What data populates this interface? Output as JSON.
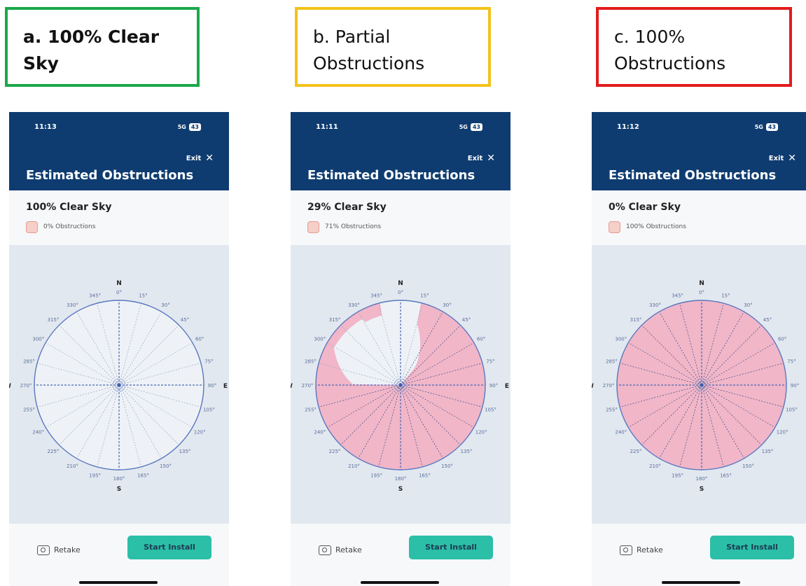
{
  "panels": [
    {
      "label": "a. 100% Clear\nSky",
      "border_color": "#1ba84a",
      "status_time": "11:13",
      "status_right": "5G",
      "battery": "43",
      "exit_label": "Exit",
      "title": "Estimated Obstructions",
      "clear_sky": "100% Clear Sky",
      "obstructions": "0% Obstructions",
      "obstructed_fraction": 0.0,
      "retake_label": "Retake",
      "start_label": "Start Install"
    },
    {
      "label": "b. Partial\nObstructions",
      "border_color": "#f3c21a",
      "status_time": "11:11",
      "status_right": "5G",
      "battery": "43",
      "exit_label": "Exit",
      "title": "Estimated Obstructions",
      "clear_sky": "29% Clear Sky",
      "obstructions": "71% Obstructions",
      "obstructed_fraction": 0.71,
      "retake_label": "Retake",
      "start_label": "Start Install"
    },
    {
      "label": "c. 100%\nObstructions",
      "border_color": "#e21c1c",
      "status_time": "11:12",
      "status_right": "5G",
      "battery": "43",
      "exit_label": "Exit",
      "title": "Estimated Obstructions",
      "clear_sky": "0% Clear Sky",
      "obstructions": "100% Obstructions",
      "obstructed_fraction": 1.0,
      "retake_label": "Retake",
      "start_label": "Start Install"
    }
  ],
  "compass": {
    "north": "N",
    "east": "E",
    "south": "S",
    "west": "W",
    "degree_labels": [
      "0°",
      "15°",
      "30°",
      "45°",
      "60°",
      "75°",
      "90°",
      "105°",
      "120°",
      "135°",
      "150°",
      "165°",
      "180°",
      "195°",
      "210°",
      "225°",
      "240°",
      "255°",
      "270°",
      "285°",
      "300°",
      "315°",
      "330°",
      "345°"
    ]
  },
  "colors": {
    "header": "#0e3c70",
    "ring": "#5a77c0",
    "obstruction_fill": "#f1b6c8",
    "start_button": "#2bbfa8"
  }
}
